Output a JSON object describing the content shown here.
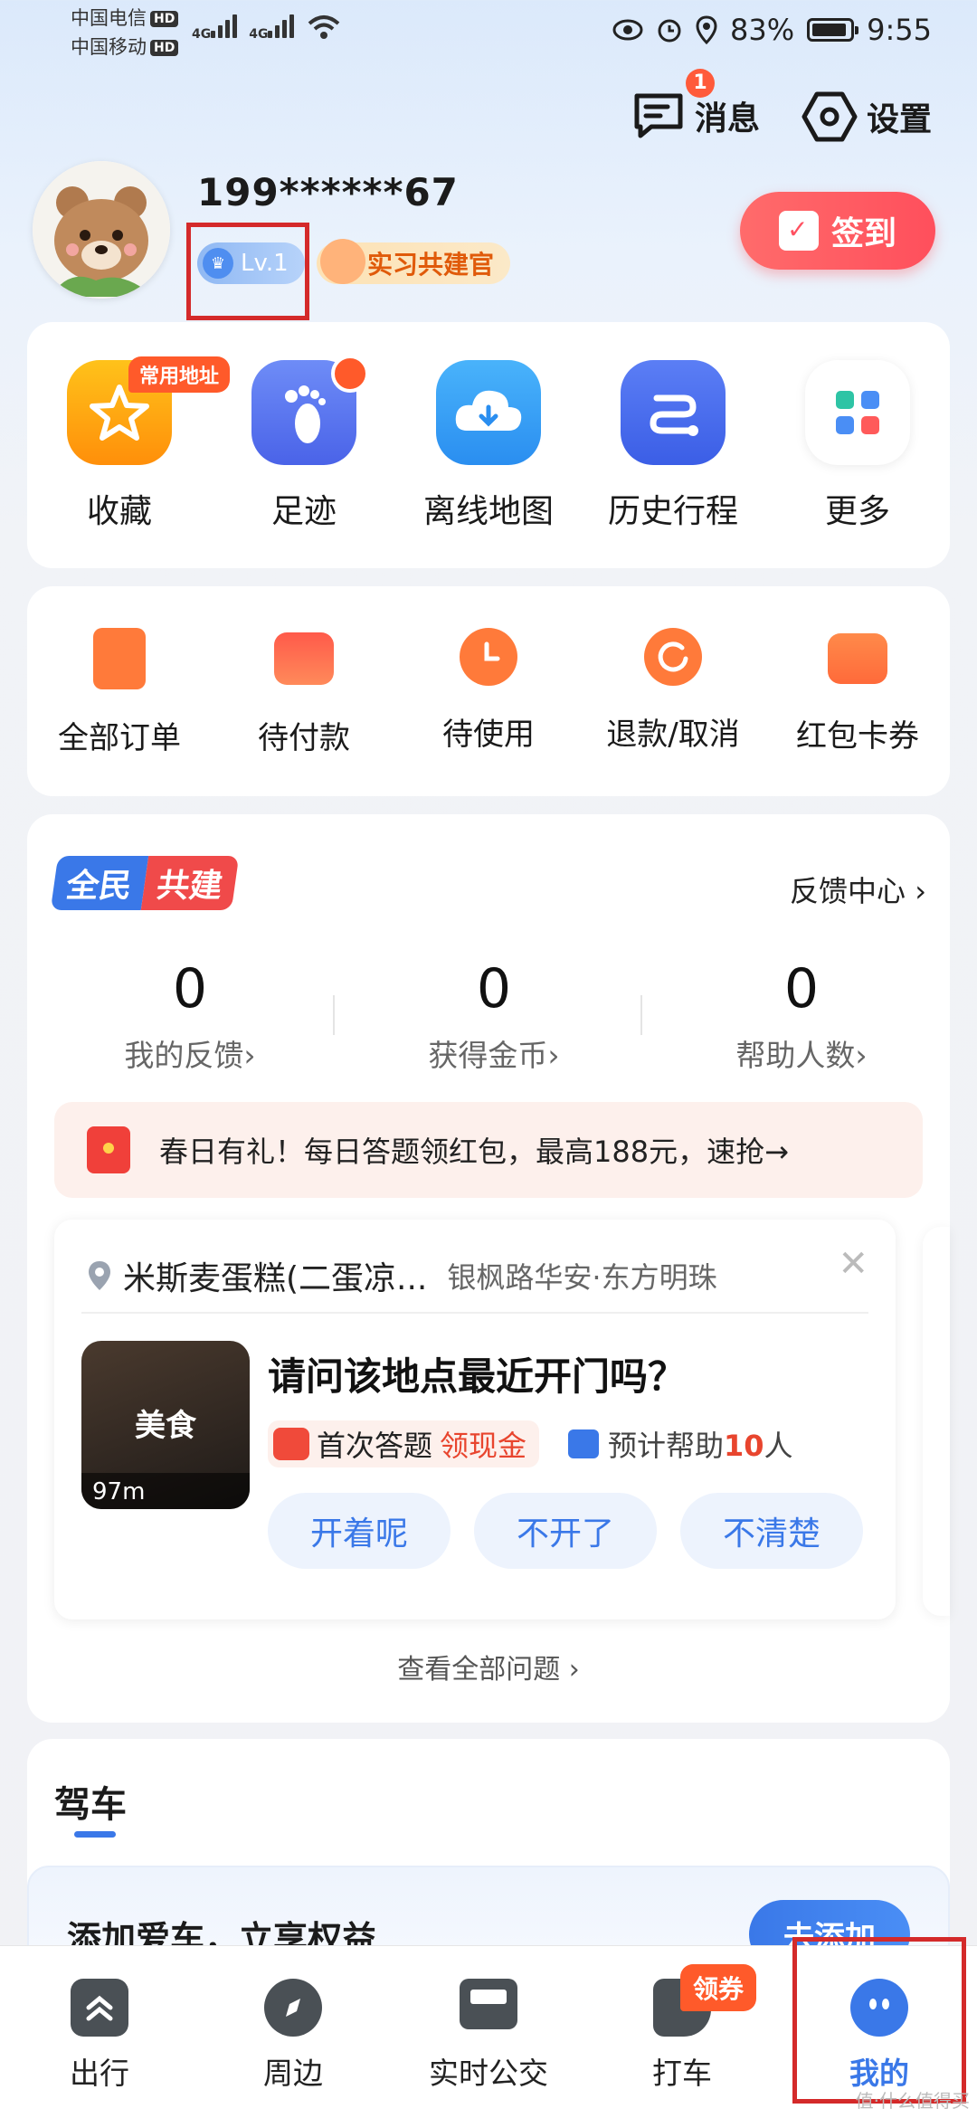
{
  "status_bar": {
    "carrier1": "中国电信",
    "carrier2": "中国移动",
    "hd": "HD",
    "network1": "4G",
    "network2": "4G",
    "battery": "83%",
    "time": "9:55"
  },
  "header": {
    "messages_label": "消息",
    "messages_badge": "1",
    "settings_label": "设置"
  },
  "profile": {
    "phone": "199******67",
    "level": "Lv.1",
    "title_badge": "实习共建官",
    "signin_label": "签到"
  },
  "quick_actions": [
    {
      "label": "收藏",
      "icon": "star-icon",
      "tag": "常用地址"
    },
    {
      "label": "足迹",
      "icon": "footprint-icon"
    },
    {
      "label": "离线地图",
      "icon": "cloud-download-icon"
    },
    {
      "label": "历史行程",
      "icon": "route-icon"
    },
    {
      "label": "更多",
      "icon": "grid-more-icon"
    }
  ],
  "orders": [
    {
      "label": "全部订单",
      "icon": "order-list-icon"
    },
    {
      "label": "待付款",
      "icon": "wallet-icon"
    },
    {
      "label": "待使用",
      "icon": "clock-icon"
    },
    {
      "label": "退款/取消",
      "icon": "refund-icon"
    },
    {
      "label": "红包卡券",
      "icon": "coupon-icon"
    }
  ],
  "build": {
    "logo_left": "全民",
    "logo_right": "共建",
    "feedback_center": "反馈中心",
    "stats": [
      {
        "value": "0",
        "label": "我的反馈"
      },
      {
        "value": "0",
        "label": "获得金币"
      },
      {
        "value": "0",
        "label": "帮助人数"
      }
    ],
    "promo": "春日有礼！每日答题领红包，最高188元，速抢→"
  },
  "question": {
    "place": "米斯麦蛋糕(二蛋凉...",
    "address": "银枫路华安·东方明珠",
    "thumb_label": "美食",
    "distance": "97m",
    "title": "请问该地点最近开门吗？",
    "reward_prefix": "首次答题",
    "reward_highlight": "领现金",
    "help_prefix": "预计帮助",
    "help_count": "10",
    "help_suffix": "人",
    "options": [
      "开着呢",
      "不开了",
      "不清楚"
    ],
    "view_all": "查看全部问题"
  },
  "driving": {
    "title": "驾车",
    "promo": "添加爱车，立享权益",
    "add_button": "去添加"
  },
  "tabs": [
    {
      "label": "出行",
      "icon": "travel-icon"
    },
    {
      "label": "周边",
      "icon": "compass-icon"
    },
    {
      "label": "实时公交",
      "icon": "bus-icon"
    },
    {
      "label": "打车",
      "icon": "taxi-icon",
      "tag": "领券"
    },
    {
      "label": "我的",
      "icon": "profile-icon",
      "active": true
    }
  ],
  "colors": {
    "accent": "#3a78e8",
    "signin": "#ff5060",
    "highlight_red": "#e8452e",
    "annotation_red": "#d42a2a"
  },
  "watermark": "值·什么值得买"
}
